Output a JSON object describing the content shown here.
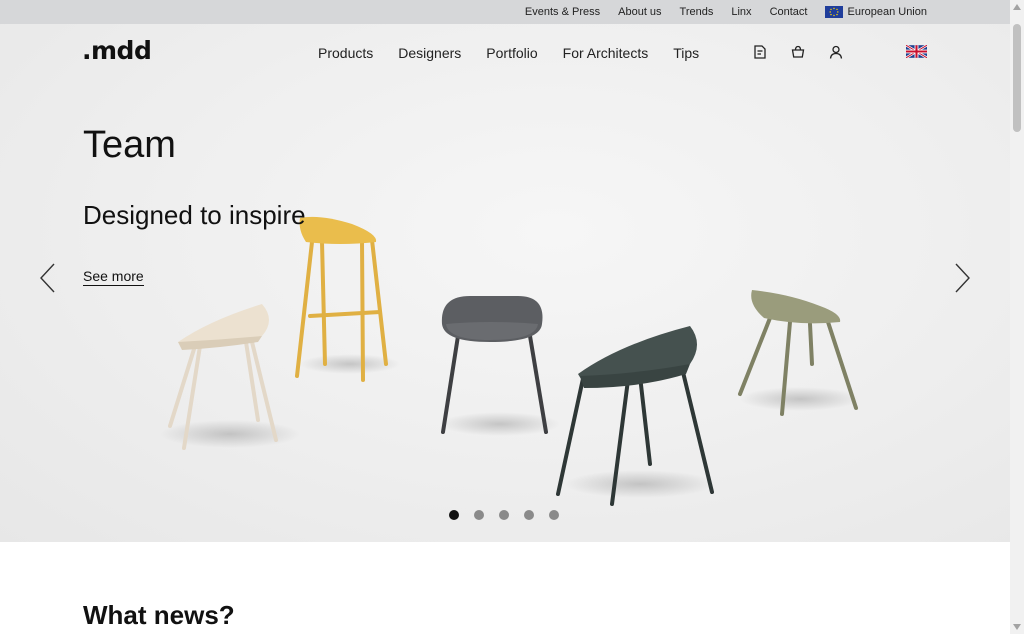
{
  "topbar": {
    "links": [
      "Events & Press",
      "About us",
      "Trends",
      "Linx",
      "Contact"
    ],
    "region": "European Union"
  },
  "header": {
    "logo": ".mdd",
    "nav": [
      "Products",
      "Designers",
      "Portfolio",
      "For Architects",
      "Tips"
    ],
    "icons": [
      "notepad-icon",
      "basket-icon",
      "user-icon"
    ],
    "language_flag": "uk-flag-icon"
  },
  "hero": {
    "title": "Team",
    "subtitle": "Designed to inspire",
    "cta": "See more",
    "slides_total": 5,
    "active_slide": 1
  },
  "news": {
    "title": "What news?"
  },
  "colors": {
    "topbar_bg": "#d6d7d9",
    "chair_cream": "#e6d9c4",
    "chair_yellow": "#e6b940",
    "chair_gray": "#55575b",
    "chair_teal": "#3f4b4a",
    "chair_olive": "#8d8f6f"
  }
}
